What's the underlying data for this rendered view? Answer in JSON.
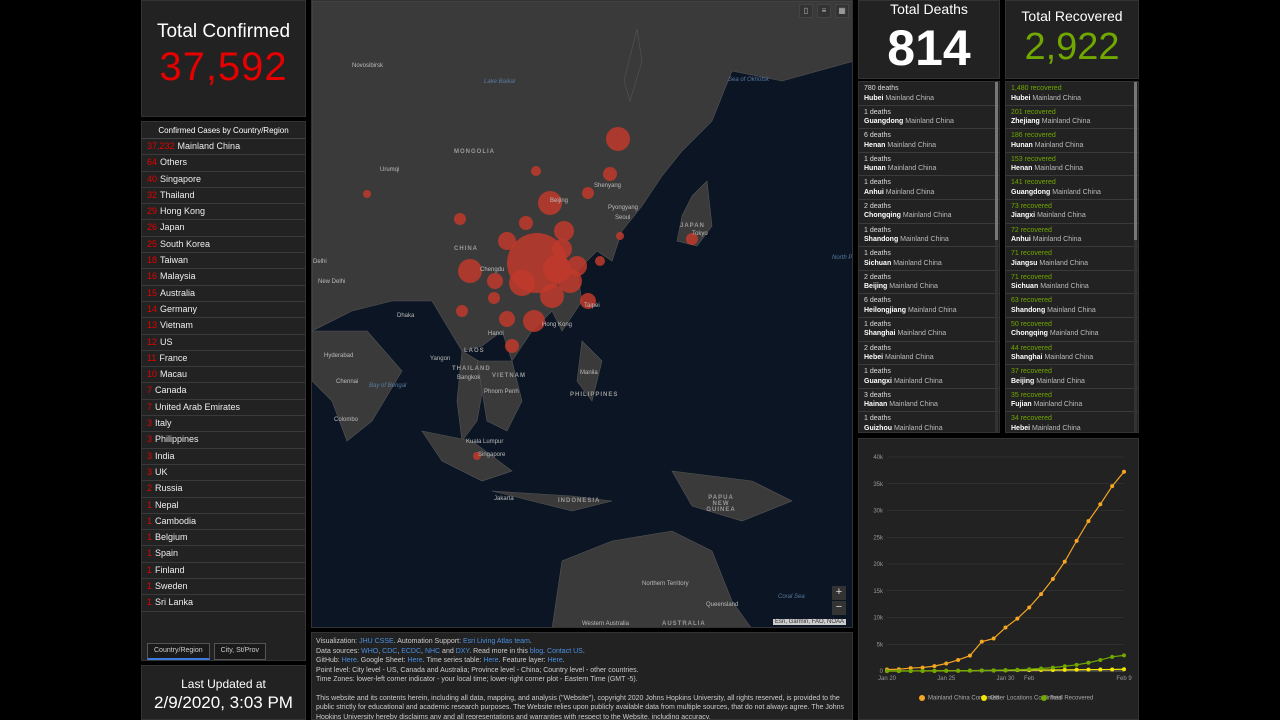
{
  "confirmed": {
    "title": "Total Confirmed",
    "value": "37,592"
  },
  "countries": {
    "header": "Confirmed Cases by Country/Region",
    "items": [
      {
        "n": "37,232",
        "name": "Mainland China"
      },
      {
        "n": "64",
        "name": "Others"
      },
      {
        "n": "40",
        "name": "Singapore"
      },
      {
        "n": "32",
        "name": "Thailand"
      },
      {
        "n": "29",
        "name": "Hong Kong"
      },
      {
        "n": "26",
        "name": "Japan"
      },
      {
        "n": "25",
        "name": "South Korea"
      },
      {
        "n": "18",
        "name": "Taiwan"
      },
      {
        "n": "16",
        "name": "Malaysia"
      },
      {
        "n": "15",
        "name": "Australia"
      },
      {
        "n": "14",
        "name": "Germany"
      },
      {
        "n": "13",
        "name": "Vietnam"
      },
      {
        "n": "12",
        "name": "US"
      },
      {
        "n": "11",
        "name": "France"
      },
      {
        "n": "10",
        "name": "Macau"
      },
      {
        "n": "7",
        "name": "Canada"
      },
      {
        "n": "7",
        "name": "United Arab Emirates"
      },
      {
        "n": "3",
        "name": "Italy"
      },
      {
        "n": "3",
        "name": "Philippines"
      },
      {
        "n": "3",
        "name": "India"
      },
      {
        "n": "3",
        "name": "UK"
      },
      {
        "n": "2",
        "name": "Russia"
      },
      {
        "n": "1",
        "name": "Nepal"
      },
      {
        "n": "1",
        "name": "Cambodia"
      },
      {
        "n": "1",
        "name": "Belgium"
      },
      {
        "n": "1",
        "name": "Spain"
      },
      {
        "n": "1",
        "name": "Finland"
      },
      {
        "n": "1",
        "name": "Sweden"
      },
      {
        "n": "1",
        "name": "Sri Lanka"
      }
    ]
  },
  "tabs": [
    {
      "label": "Country/Region"
    },
    {
      "label": "City, St/Prov"
    }
  ],
  "updated": {
    "label": "Last Updated at",
    "value": "2/9/2020, 3:03 PM"
  },
  "map": {
    "labels": [
      "Novosibirsk",
      "Lake Baikal",
      "Sea of Okhotsk",
      "MONGOLIA",
      "Urumqi",
      "Shenyang",
      "Beijing",
      "Pyongyang",
      "Seoul",
      "JAPAN",
      "Tokyo",
      "CHINA",
      "Chengdu",
      "New Delhi",
      "North Pacific Ocean",
      "Dhaka",
      "Taipei",
      "Hong Kong",
      "Hanoi",
      "Hyderabad",
      "Yangon",
      "LAOS",
      "THAILAND",
      "VIETNAM",
      "Bangkok",
      "Manila",
      "Chennai",
      "Bay of Bengal",
      "Phnom Penh",
      "PHILIPPINES",
      "Colombo",
      "Kuala Lumpur",
      "Singapore",
      "Jakarta",
      "INDONESIA",
      "PAPUA NEW GUINEA",
      "Northern Territory",
      "Queensland",
      "AUSTRALIA",
      "Western Australia",
      "Coral Sea",
      "Delhi"
    ],
    "attribution": "Esri, Garmin, FAO, NOAA",
    "zoom_in": "+",
    "zoom_out": "−"
  },
  "info": {
    "l1_pre": "Visualization: ",
    "l1_a": "JHU CSSE",
    "l1_mid": ". Automation Support: ",
    "l1_b": "Esri Living Atlas team",
    "l1_end": ".",
    "l2_pre": "Data sources: ",
    "l2_s1": "WHO",
    "l2_s2": "CDC",
    "l2_s3": "ECDC",
    "l2_s4": "NHC",
    "l2_and": " and ",
    "l2_s5": "DXY",
    "l2_mid": ". Read more in this ",
    "l2_blog": "blog",
    "l2_dot": ". ",
    "l2_contact": "Contact US",
    "l2_end": ".",
    "l3_pre": "GitHub: ",
    "l3_h1": "Here",
    "l3_mid1": ". Google Sheet: ",
    "l3_h2": "Here",
    "l3_mid2": ". Time series table: ",
    "l3_h3": "Here",
    "l3_mid3": ". Feature layer: ",
    "l3_h4": "Here",
    "l3_end": ".",
    "l4": "Point level: City level - US, Canada and Australia; Province level - China; Country level - other countries.",
    "l5": "Time Zones: lower-left corner indicator - your local time; lower-right corner plot - Eastern Time (GMT -5).",
    "l6": "This website and its contents herein, including all data, mapping, and analysis (\"Website\"), copyright 2020 Johns Hopkins University, all rights reserved, is provided to the public strictly for educational and academic research purposes.  The Website relies upon publicly available data from multiple sources, that do not always agree. The Johns Hopkins University hereby disclaims any and all representations and warranties with respect to the Website, including accuracy,"
  },
  "deaths": {
    "title": "Total Deaths",
    "value": "814",
    "items": [
      {
        "v": "780 deaths",
        "b": "Hubei",
        "r": "Mainland China"
      },
      {
        "v": "1 deaths",
        "b": "Guangdong",
        "r": "Mainland China"
      },
      {
        "v": "6 deaths",
        "b": "Henan",
        "r": "Mainland China"
      },
      {
        "v": "1 deaths",
        "b": "Hunan",
        "r": "Mainland China"
      },
      {
        "v": "1 deaths",
        "b": "Anhui",
        "r": "Mainland China"
      },
      {
        "v": "2 deaths",
        "b": "Chongqing",
        "r": "Mainland China"
      },
      {
        "v": "1 deaths",
        "b": "Shandong",
        "r": "Mainland China"
      },
      {
        "v": "1 deaths",
        "b": "Sichuan",
        "r": "Mainland China"
      },
      {
        "v": "2 deaths",
        "b": "Beijing",
        "r": "Mainland China"
      },
      {
        "v": "6 deaths",
        "b": "Heilongjiang",
        "r": "Mainland China"
      },
      {
        "v": "1 deaths",
        "b": "Shanghai",
        "r": "Mainland China"
      },
      {
        "v": "2 deaths",
        "b": "Hebei",
        "r": "Mainland China"
      },
      {
        "v": "1 deaths",
        "b": "Guangxi",
        "r": "Mainland China"
      },
      {
        "v": "3 deaths",
        "b": "Hainan",
        "r": "Mainland China"
      },
      {
        "v": "1 deaths",
        "b": "Guizhou",
        "r": "Mainland China"
      }
    ]
  },
  "recovered": {
    "title": "Total Recovered",
    "value": "2,922",
    "items": [
      {
        "v": "1,480 recovered",
        "b": "Hubei",
        "r": "Mainland China"
      },
      {
        "v": "201 recovered",
        "b": "Zhejiang",
        "r": "Mainland China"
      },
      {
        "v": "186 recovered",
        "b": "Hunan",
        "r": "Mainland China"
      },
      {
        "v": "153 recovered",
        "b": "Henan",
        "r": "Mainland China"
      },
      {
        "v": "141 recovered",
        "b": "Guangdong",
        "r": "Mainland China"
      },
      {
        "v": "73 recovered",
        "b": "Jiangxi",
        "r": "Mainland China"
      },
      {
        "v": "72 recovered",
        "b": "Anhui",
        "r": "Mainland China"
      },
      {
        "v": "71 recovered",
        "b": "Jiangsu",
        "r": "Mainland China"
      },
      {
        "v": "71 recovered",
        "b": "Sichuan",
        "r": "Mainland China"
      },
      {
        "v": "63 recovered",
        "b": "Shandong",
        "r": "Mainland China"
      },
      {
        "v": "50 recovered",
        "b": "Chongqing",
        "r": "Mainland China"
      },
      {
        "v": "44 recovered",
        "b": "Shanghai",
        "r": "Mainland China"
      },
      {
        "v": "37 recovered",
        "b": "Beijing",
        "r": "Mainland China"
      },
      {
        "v": "35 recovered",
        "b": "Fujian",
        "r": "Mainland China"
      },
      {
        "v": "34 recovered",
        "b": "Hebei",
        "r": "Mainland China"
      }
    ]
  },
  "colors": {
    "confirmed": "#e60000",
    "recovered": "#70a800",
    "china_line": "#f5a623",
    "other_line": "#f2e600",
    "recovered_line": "#70a800",
    "map_bubble": "#c0392b"
  },
  "chart_data": {
    "type": "line",
    "x_tick_labels": [
      "Jan 20",
      "Jan 25",
      "Jan 30",
      "Feb",
      "Feb 9"
    ],
    "x_tick_positions": [
      0,
      5,
      10,
      12,
      20
    ],
    "ylim": [
      0,
      40000
    ],
    "y_tick_labels": [
      "0",
      "5k",
      "10k",
      "15k",
      "20k",
      "25k",
      "30k",
      "35k",
      "40k"
    ],
    "x": [
      0,
      1,
      2,
      3,
      4,
      5,
      6,
      7,
      8,
      9,
      10,
      11,
      12,
      13,
      14,
      15,
      16,
      17,
      18,
      19,
      20
    ],
    "series": [
      {
        "name": "Mainland China Confirmed",
        "values": [
          278,
          326,
          547,
          639,
          916,
          1399,
          2062,
          2863,
          5494,
          6070,
          8124,
          9783,
          11871,
          14380,
          17205,
          20440,
          24324,
          28018,
          31161,
          34546,
          37232
        ]
      },
      {
        "name": "Other Locations Confirmed",
        "values": [
          4,
          6,
          8,
          14,
          25,
          40,
          57,
          64,
          87,
          105,
          118,
          153,
          173,
          183,
          188,
          212,
          227,
          265,
          270,
          288,
          330
        ]
      },
      {
        "name": "Total Recovered",
        "values": [
          0,
          0,
          0,
          34,
          38,
          49,
          51,
          60,
          103,
          124,
          171,
          243,
          328,
          475,
          632,
          892,
          1152,
          1540,
          2050,
          2649,
          2922
        ]
      }
    ]
  }
}
